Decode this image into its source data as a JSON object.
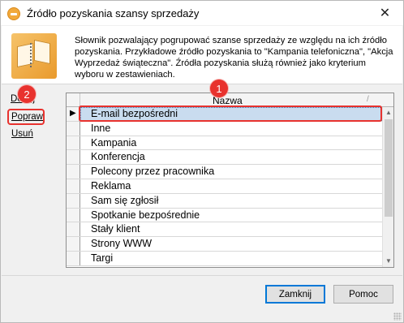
{
  "window": {
    "title": "Źródło pozyskania szansy sprzedaży",
    "close_glyph": "✕"
  },
  "description": "Słownik pozwalający pogrupować szanse sprzedaży ze względu na ich źródło pozyskania. Przykładowe źródło pozyskania to \"Kampania telefoniczna\", \"Akcja Wyprzedaż świąteczna\". Źródła pozyskania służą również jako kryterium wyboru w zestawieniach.",
  "side_actions": [
    {
      "label": "Dodaj"
    },
    {
      "label": "Popraw"
    },
    {
      "label": "Usuń"
    }
  ],
  "annotations": {
    "badge_1": "1",
    "badge_2": "2",
    "accent_color": "#e8322e"
  },
  "grid": {
    "column_header": "Nazwa",
    "sort_indicator": "/",
    "rows": [
      {
        "name": "E-mail bezpośredni",
        "selected": true
      },
      {
        "name": "Inne"
      },
      {
        "name": "Kampania"
      },
      {
        "name": "Konferencja"
      },
      {
        "name": "Polecony przez pracownika"
      },
      {
        "name": "Reklama"
      },
      {
        "name": "Sam się zgłosił"
      },
      {
        "name": "Spotkanie bezpośrednie"
      },
      {
        "name": "Stały klient"
      },
      {
        "name": "Strony WWW"
      },
      {
        "name": "Targi"
      }
    ]
  },
  "buttons": {
    "close": "Zamknij",
    "help": "Pomoc"
  }
}
